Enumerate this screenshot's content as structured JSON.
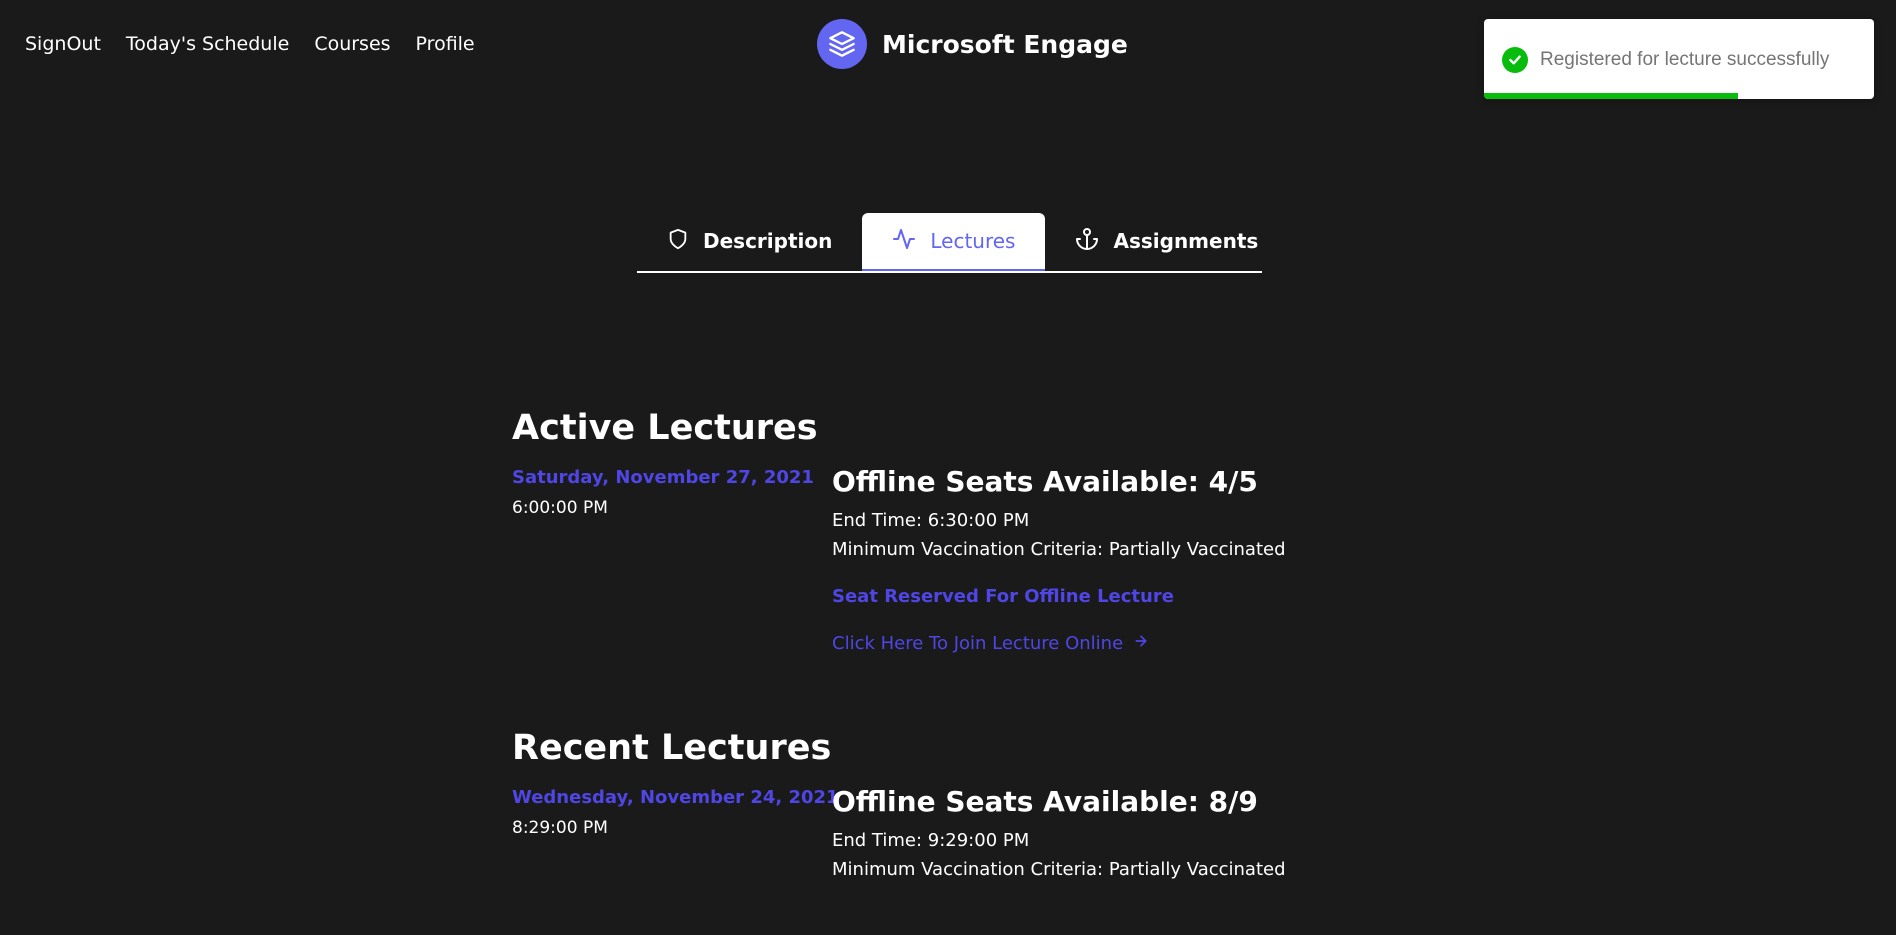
{
  "nav": {
    "items": [
      "SignOut",
      "Today's Schedule",
      "Courses",
      "Profile"
    ]
  },
  "brand": {
    "name": "Microsoft Engage",
    "logo_icon": "layers-icon",
    "logo_color": "#6366f1"
  },
  "toast": {
    "message": "Registered for lecture successfully",
    "icon": "check-circle-icon",
    "color": "#07bc0c",
    "progress": 0.65
  },
  "tabs": [
    {
      "label": "Description",
      "icon": "shield-icon",
      "active": false
    },
    {
      "label": "Lectures",
      "icon": "activity-icon",
      "active": true
    },
    {
      "label": "Assignments",
      "icon": "anchor-icon",
      "active": false
    }
  ],
  "active_lectures": {
    "title": "Active Lectures",
    "items": [
      {
        "date": "Saturday, November 27, 2021",
        "time": "6:00:00 PM",
        "seats": "Offline Seats Available: 4/5",
        "end_time": "End Time: 6:30:00 PM",
        "vaccination": "Minimum Vaccination Criteria: Partially Vaccinated",
        "reserved": "Seat Reserved For Offline Lecture",
        "join": "Click Here To Join Lecture Online"
      }
    ]
  },
  "recent_lectures": {
    "title": "Recent Lectures",
    "items": [
      {
        "date": "Wednesday, November 24, 2021",
        "time": "8:29:00 PM",
        "seats": "Offline Seats Available: 8/9",
        "end_time": "End Time: 9:29:00 PM",
        "vaccination": "Minimum Vaccination Criteria: Partially Vaccinated"
      }
    ]
  },
  "colors": {
    "background": "#1a1a1a",
    "accent": "#6366f1",
    "link": "#4f46e5"
  }
}
